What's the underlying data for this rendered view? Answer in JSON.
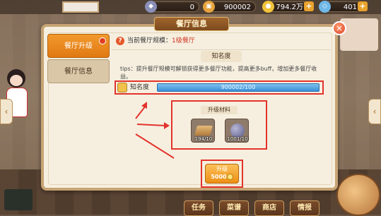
{
  "topbar": {
    "resources": [
      {
        "name": "gem",
        "value": "0",
        "icon": "gem-icon",
        "color": "#8a8fb8"
      },
      {
        "name": "chest",
        "value": "900002",
        "icon": "chest-icon",
        "color": "#e6a23c"
      },
      {
        "name": "gold",
        "value": "794.2万",
        "icon": "coin-icon",
        "color": "#f2c33a"
      },
      {
        "name": "diamond",
        "value": "401",
        "icon": "diamond-icon",
        "color": "#6fb8e8"
      }
    ]
  },
  "panel": {
    "title": "餐厅信息",
    "tabs": [
      {
        "label": "餐厅升级",
        "active": true
      },
      {
        "label": "餐厅信息",
        "active": false
      }
    ],
    "current_scale_label": "当前餐厅规模：",
    "current_scale_value": "1级餐厅",
    "fame_header": "知名度",
    "tips": "tips：提升餐厅规模可解锁获得更多餐厅功能，提高更多buff，增加更多餐厅收益。",
    "fame_label": "知名度",
    "fame_value": "900002/100",
    "fame_progress": 1.0,
    "materials_title": "升级材料",
    "materials": [
      {
        "name": "wood",
        "count": "194/10",
        "icon": "wood-plank-icon"
      },
      {
        "name": "stone",
        "count": "1001/10",
        "icon": "stone-ore-icon"
      }
    ],
    "upgrade_label": "升级",
    "upgrade_cost": "5000"
  },
  "bottom_nav": {
    "items": [
      "任务",
      "菜谱",
      "商店",
      "情报"
    ]
  },
  "colors": {
    "accent_orange": "#ee8f14",
    "highlight_red": "#e3332c",
    "progress_blue": "#3a8fd6"
  }
}
